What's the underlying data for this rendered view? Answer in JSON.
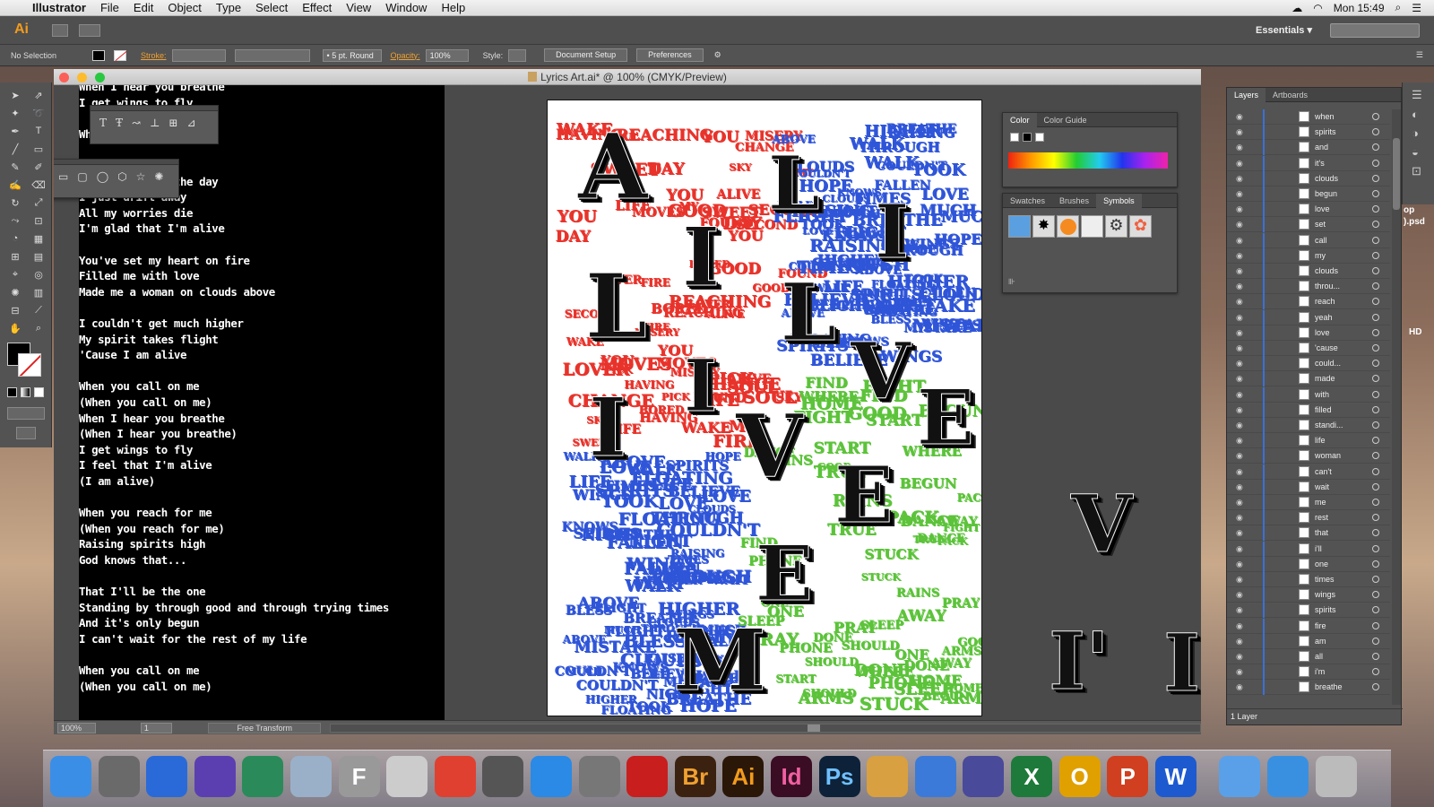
{
  "menubar": {
    "app": "Illustrator",
    "items": [
      "File",
      "Edit",
      "Object",
      "Type",
      "Select",
      "Effect",
      "View",
      "Window",
      "Help"
    ],
    "clock": "Mon 15:49"
  },
  "appbar": {
    "logo": "Ai",
    "workspace": "Essentials ▾"
  },
  "control_bar": {
    "selection": "No Selection",
    "stroke_label": "Stroke:",
    "brush": "• 5 pt. Round",
    "opacity_label": "Opacity:",
    "opacity_value": "100%",
    "style_label": "Style:",
    "document_setup": "Document Setup",
    "preferences": "Preferences"
  },
  "document": {
    "title": "Lyrics Art.ai* @ 100% (CMYK/Preview)",
    "zoom": "100%",
    "page": "1",
    "status_mode": "Free Transform"
  },
  "lyrics": [
    "When I hear you breathe",
    "I get wings to fly",
    "",
    "When you look at me",
    "",
    "",
    "When you bless the day",
    "I just drift away",
    "All my worries die",
    "I'm glad that I'm alive",
    "",
    "You've set my heart on fire",
    "Filled me with love",
    "Made me a woman on clouds above",
    "",
    "I couldn't get much higher",
    "My spirit takes flight",
    "'Cause I am alive",
    "",
    "When you call on me",
    "(When you call on me)",
    "When I hear you breathe",
    "(When I hear you breathe)",
    "I get wings to fly",
    "I feel that I'm alive",
    "(I am alive)",
    "",
    "When you reach for me",
    "(When you reach for me)",
    "Raising spirits high",
    "God knows that...",
    "",
    "That I'll be the one",
    "Standing by through good and through trying times",
    "And it's only begun",
    "I can't wait for the rest of my life",
    "",
    "When you call on me",
    "(When you call on me)"
  ],
  "artboard": {
    "big_letters": [
      "A",
      "L",
      "I",
      "L",
      "I",
      "L",
      "I",
      "V",
      "I",
      "V",
      "E",
      "E",
      "E",
      "M"
    ],
    "red_words": [
      "SECOND",
      "PICK",
      "HAVING",
      "FOUND",
      "GOOD",
      "BORED",
      "CHANGE",
      "YOU",
      "REACHING",
      "YOU",
      "WAKE",
      "MISERY",
      "LIFE",
      "ALIVE",
      "SWEET",
      "SOUL",
      "MOVES",
      "LOVER",
      "FIRE",
      "DAY",
      "MY",
      "SKY"
    ],
    "blue_words": [
      "WINGS",
      "MUCH",
      "HIGHER",
      "TOOK",
      "FLIGHT",
      "BLESS",
      "CLOUDS",
      "THROUGH",
      "WAIT",
      "LIFE",
      "MISTAKE",
      "COULDN'T",
      "RAISING",
      "ABOVE",
      "NIGHT",
      "BREATHE",
      "WALK",
      "HOPE",
      "BELIEVE",
      "TIMES",
      "SPIRITS",
      "FALLEN",
      "LOVE",
      "FLOATING",
      "KNOWS"
    ],
    "green_words": [
      "SLEEP",
      "ARMS",
      "WHERE",
      "HOME",
      "TRUE",
      "BEGUN",
      "SHOULD",
      "DANCE",
      "RAINS",
      "PRAY",
      "START",
      "FIGHT",
      "DONE",
      "PHONE",
      "STUCK",
      "PACK",
      "AWAY",
      "FIND",
      "ONE",
      "GOOD"
    ]
  },
  "outside_art": {
    "letters": [
      "V",
      "I'",
      "I'"
    ]
  },
  "color_panel": {
    "tabs": [
      "Color",
      "Color Guide"
    ]
  },
  "swatch_panel": {
    "tabs": [
      "Swatches",
      "Brushes",
      "Symbols"
    ]
  },
  "layers_panel": {
    "tabs": [
      "Layers",
      "Artboards"
    ],
    "rows": [
      "when",
      "spirits",
      "and",
      "it's",
      "clouds",
      "begun",
      "love",
      "set",
      "call",
      "my",
      "clouds",
      "throu...",
      "reach",
      "yeah",
      "love",
      "'cause",
      "could...",
      "made",
      "with",
      "filled",
      "standi...",
      "life",
      "woman",
      "can't",
      "wait",
      "me",
      "rest",
      "that",
      "i'll",
      "one",
      "times",
      "wings",
      "spirits",
      "fire",
      "am",
      "all",
      "i'm",
      "breathe"
    ],
    "footer": "1 Layer"
  },
  "side_labels": {
    "psd": "op\n).psd",
    "hd": "HD"
  },
  "dock": {
    "apps": [
      "Finder",
      "Image Capture",
      "Mail",
      "iMovie",
      "Photos",
      "Preview",
      "Font Book",
      "Scissors",
      "Chrome",
      "Launchpad",
      "Safari",
      "System Preferences",
      "Acrobat",
      "Br",
      "Ai",
      "Id",
      "Ps",
      "Keynote",
      "Numbers",
      "Script",
      "Excel",
      "Outlook",
      "PowerPoint",
      "Word",
      "Applications",
      "Folder",
      "Trash"
    ]
  }
}
